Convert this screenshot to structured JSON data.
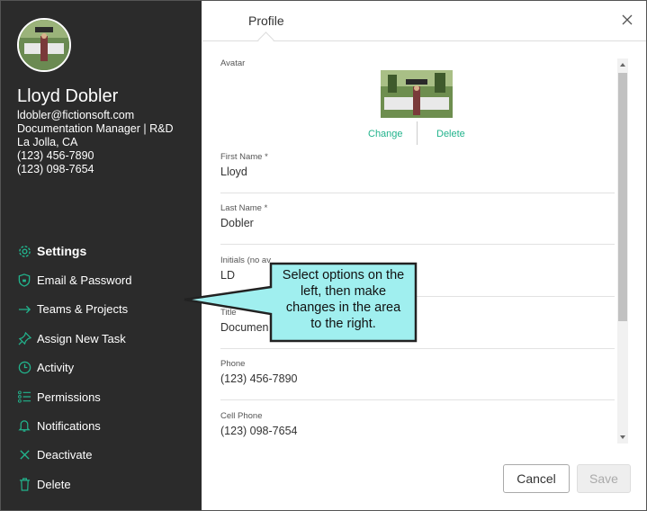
{
  "profile": {
    "name": "Lloyd Dobler",
    "email": "ldobler@fictionsoft.com",
    "role": "Documentation Manager | R&D",
    "location": "La Jolla, CA",
    "phone": "(123) 456-7890",
    "cell": "(123) 098-7654"
  },
  "nav": [
    {
      "label": "Settings",
      "icon": "gear-icon"
    },
    {
      "label": "Email & Password",
      "icon": "shield-icon"
    },
    {
      "label": "Teams & Projects",
      "icon": "arrow-right-icon"
    },
    {
      "label": "Assign New Task",
      "icon": "pin-icon"
    },
    {
      "label": "Activity",
      "icon": "clock-icon"
    },
    {
      "label": "Permissions",
      "icon": "list-icon"
    },
    {
      "label": "Notifications",
      "icon": "bell-icon"
    },
    {
      "label": "Deactivate",
      "icon": "x-icon"
    },
    {
      "label": "Delete",
      "icon": "trash-icon"
    }
  ],
  "header": {
    "tab": "Profile"
  },
  "form": {
    "avatar_label": "Avatar",
    "change": "Change",
    "delete": "Delete",
    "first_name_label": "First Name *",
    "first_name": "Lloyd",
    "last_name_label": "Last Name *",
    "last_name": "Dobler",
    "initials_label": "Initials (no av",
    "initials": "LD",
    "title_label": "Title",
    "title": "Documen",
    "phone_label": "Phone",
    "phone": "(123) 456-7890",
    "cell_label": "Cell Phone",
    "cell": "(123) 098-7654"
  },
  "footer": {
    "cancel": "Cancel",
    "save": "Save"
  },
  "callout": {
    "line1": "Select options on the",
    "line2": "left, then make",
    "line3": "changes in the area",
    "line4": "to the right."
  },
  "colors": {
    "sidebar": "#2b2b2b",
    "accent": "#22b38c",
    "callout": "#a0efef"
  }
}
